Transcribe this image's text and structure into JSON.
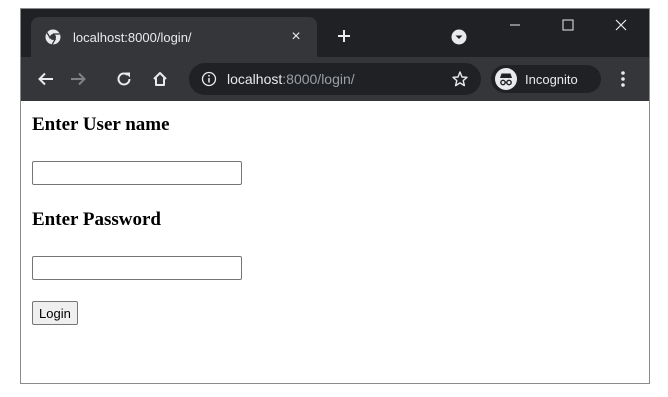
{
  "tab": {
    "title": "localhost:8000/login/",
    "close_glyph": "×",
    "favicon": "chrome-logo-icon"
  },
  "newtab_glyph": "+",
  "window_controls": {
    "minimize": "–",
    "maximize": "☐",
    "close": "✕"
  },
  "address_bar": {
    "host": "localhost",
    "rest": ":8000/login/"
  },
  "incognito": {
    "label": "Incognito"
  },
  "form": {
    "username_heading": "Enter User name",
    "username_value": "",
    "password_heading": "Enter Password",
    "password_value": "",
    "login_label": "Login"
  },
  "colors": {
    "tabstrip": "#202124",
    "toolbar": "#35363a",
    "omnibox": "#202124",
    "text_light": "#e8eaed"
  }
}
